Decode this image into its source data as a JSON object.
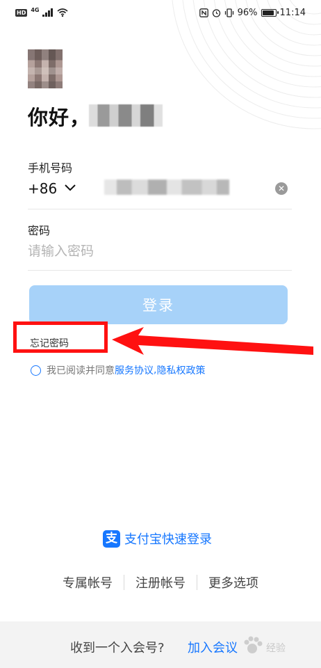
{
  "status_bar": {
    "network_badge": "HD",
    "network_type": "4G",
    "battery_text": "96%",
    "battery_level": 0.96,
    "time": "11:14"
  },
  "greeting": "你好，",
  "phone": {
    "label": "手机号码",
    "country_code": "+86"
  },
  "password": {
    "label": "密码",
    "placeholder": "请输入密码"
  },
  "login_button": "登录",
  "forgot_password": "忘记密码",
  "agreement": {
    "prefix": "我已阅读并同意",
    "service": "服务协议",
    "separator": ",",
    "privacy": "隐私权政策"
  },
  "alipay": {
    "icon_char": "支",
    "label": "支付宝快速登录"
  },
  "bottom_links": [
    "专属帐号",
    "注册帐号",
    "更多选项"
  ],
  "footer": {
    "text": "收到一个入会号?",
    "link": "加入会议"
  },
  "watermark": "经验",
  "colors": {
    "accent": "#1677ff",
    "login_button_bg": "#a7d2f9",
    "annotation_red": "#ff1111"
  }
}
